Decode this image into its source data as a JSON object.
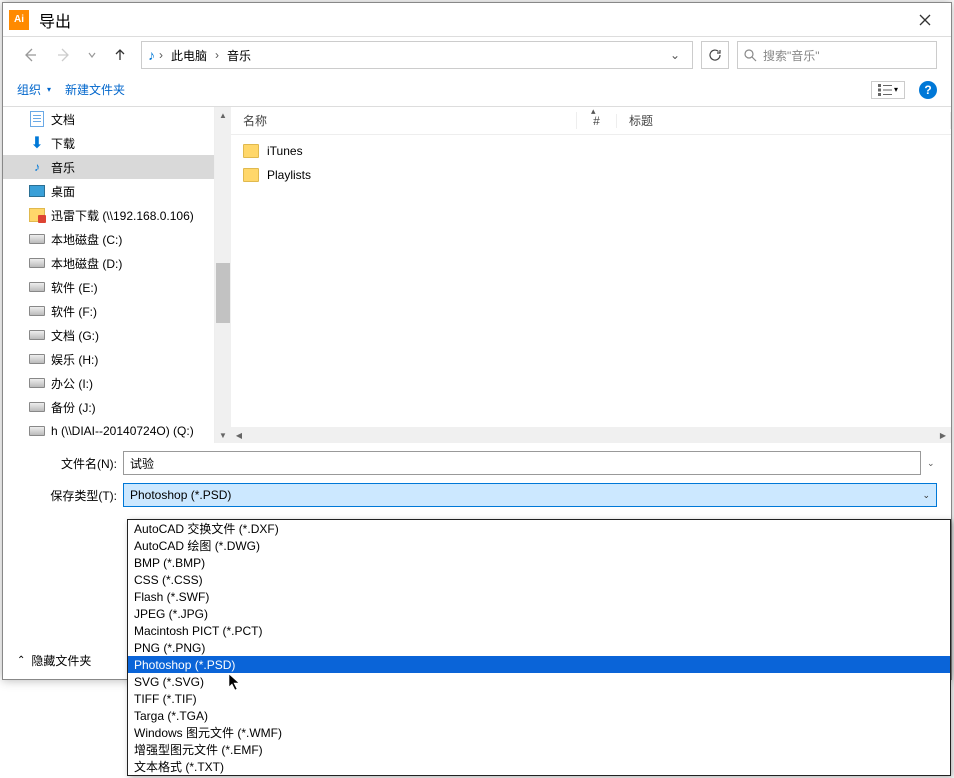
{
  "title": "导出",
  "breadcrumb": {
    "item1": "此电脑",
    "item2": "音乐"
  },
  "search": {
    "placeholder": "搜索\"音乐\""
  },
  "toolbar": {
    "organize": "组织",
    "new_folder": "新建文件夹"
  },
  "columns": {
    "name": "名称",
    "num": "#",
    "title": "标题"
  },
  "tree": [
    {
      "label": "文档",
      "icon": "docs"
    },
    {
      "label": "下载",
      "icon": "dl"
    },
    {
      "label": "音乐",
      "icon": "music",
      "selected": true
    },
    {
      "label": "桌面",
      "icon": "desktop"
    },
    {
      "label": "迅雷下载 (\\\\192.168.0.106)",
      "icon": "net"
    },
    {
      "label": "本地磁盘 (C:)",
      "icon": "disk"
    },
    {
      "label": "本地磁盘 (D:)",
      "icon": "disk"
    },
    {
      "label": "软件 (E:)",
      "icon": "disk"
    },
    {
      "label": "软件 (F:)",
      "icon": "disk"
    },
    {
      "label": "文档 (G:)",
      "icon": "disk"
    },
    {
      "label": "娱乐 (H:)",
      "icon": "disk"
    },
    {
      "label": "办公 (I:)",
      "icon": "disk"
    },
    {
      "label": "备份 (J:)",
      "icon": "disk"
    },
    {
      "label": "h (\\\\DIAI--20140724O) (Q:)",
      "icon": "disk"
    }
  ],
  "rows": [
    {
      "name": "iTunes"
    },
    {
      "name": "Playlists"
    }
  ],
  "form": {
    "filename_label": "文件名(N):",
    "filename_value": "试验",
    "type_label": "保存类型(T):",
    "type_value": "Photoshop (*.PSD)"
  },
  "hide_folders": "隐藏文件夹",
  "dropdown_options": [
    "AutoCAD 交换文件 (*.DXF)",
    "AutoCAD 绘图 (*.DWG)",
    "BMP (*.BMP)",
    "CSS (*.CSS)",
    "Flash (*.SWF)",
    "JPEG (*.JPG)",
    "Macintosh PICT (*.PCT)",
    "PNG (*.PNG)",
    "Photoshop (*.PSD)",
    "SVG (*.SVG)",
    "TIFF (*.TIF)",
    "Targa (*.TGA)",
    "Windows 图元文件 (*.WMF)",
    "增强型图元文件 (*.EMF)",
    "文本格式 (*.TXT)"
  ],
  "dropdown_selected_index": 8
}
